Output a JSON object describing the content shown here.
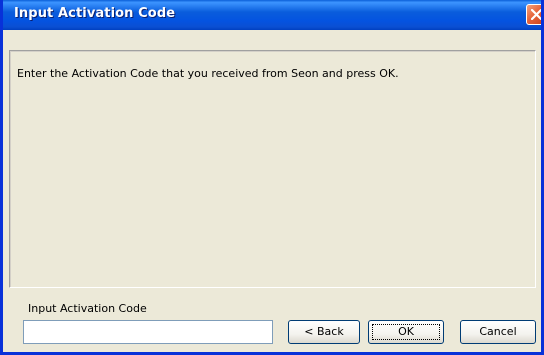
{
  "window": {
    "title": "Input Activation Code"
  },
  "main": {
    "instruction": "Enter the Activation Code that you received from Seon and press OK."
  },
  "form": {
    "field_label": "Input Activation Code",
    "field_value": ""
  },
  "buttons": {
    "back_label": "< Back",
    "ok_label": "OK",
    "cancel_label": "Cancel"
  },
  "icons": {
    "close": "close-icon"
  },
  "colors": {
    "titlebar": "#0a5ddc",
    "close_button": "#e6633a",
    "dialog_background": "#ece9d8"
  }
}
